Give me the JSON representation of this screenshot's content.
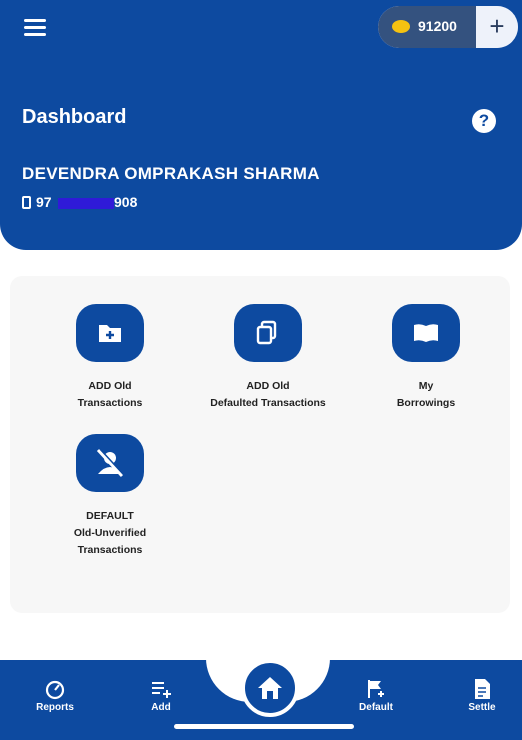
{
  "header": {
    "title": "Dashboard",
    "user_name": "DEVENDRA OMPRAKASH SHARMA",
    "phone_prefix": "97",
    "phone_suffix": "908",
    "coins": "91200",
    "add_symbol": "+",
    "help_symbol": "?"
  },
  "actions": [
    {
      "label_line1": "ADD Old",
      "label_line2": "Transactions",
      "label_line3": "",
      "icon": "add-folder-icon"
    },
    {
      "label_line1": "ADD Old",
      "label_line2": "Defaulted Transactions",
      "label_line3": "",
      "icon": "copy-icon"
    },
    {
      "label_line1": "My",
      "label_line2": "Borrowings",
      "label_line3": "",
      "icon": "book-icon"
    },
    {
      "label_line1": "DEFAULT",
      "label_line2": "Old-Unverified",
      "label_line3": "Transactions",
      "icon": "user-off-icon"
    }
  ],
  "bottom_nav": [
    {
      "label": "Reports",
      "icon": "speedometer-icon"
    },
    {
      "label": "Add",
      "icon": "list-add-icon"
    },
    {
      "label": "",
      "icon": "home-icon"
    },
    {
      "label": "Default",
      "icon": "flag-icon"
    },
    {
      "label": "Settle",
      "icon": "document-icon"
    }
  ],
  "colors": {
    "primary": "#0d4aa0",
    "card_bg": "#f7f7f7",
    "coin": "#f5c211",
    "mask": "#2f1ad8"
  }
}
